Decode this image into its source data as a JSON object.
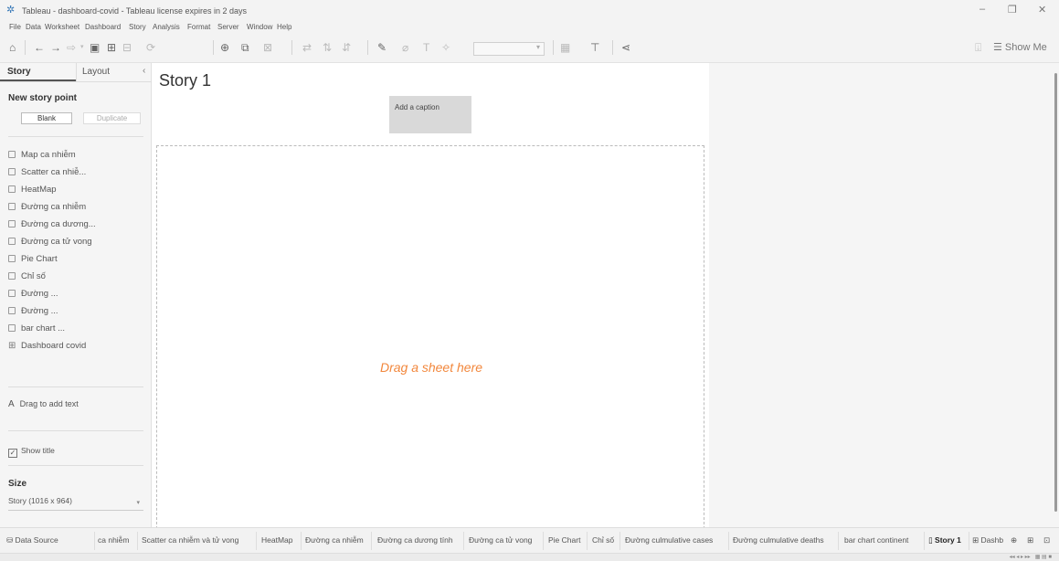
{
  "window": {
    "title": "Tableau - dashboard-covid - Tableau license expires in 2 days",
    "app_icon": "tableau-logo-icon"
  },
  "menu": [
    "File",
    "Data",
    "Worksheet",
    "Dashboard",
    "Story",
    "Analysis",
    "Format",
    "Server",
    "Window",
    "Help"
  ],
  "toolbar": {
    "show_me_label": "Show Me"
  },
  "sidebar": {
    "tabs": {
      "story": "Story",
      "layout": "Layout"
    },
    "new_story_point": "New story point",
    "blank_button": "Blank",
    "duplicate_button": "Duplicate",
    "sheets": [
      {
        "label": "Map ca nhiễm",
        "kind": "worksheet"
      },
      {
        "label": "Scatter ca nhiễ...",
        "kind": "worksheet"
      },
      {
        "label": "HeatMap",
        "kind": "worksheet"
      },
      {
        "label": "Đường ca nhiễm",
        "kind": "worksheet"
      },
      {
        "label": "Đường ca dương...",
        "kind": "worksheet"
      },
      {
        "label": "Đường ca tử vong",
        "kind": "worksheet"
      },
      {
        "label": "Pie Chart",
        "kind": "worksheet"
      },
      {
        "label": "Chỉ số",
        "kind": "worksheet"
      },
      {
        "label": "Đường ...",
        "kind": "worksheet"
      },
      {
        "label": "Đường ...",
        "kind": "worksheet"
      },
      {
        "label": "bar chart ...",
        "kind": "worksheet"
      },
      {
        "label": "Dashboard covid",
        "kind": "dashboard"
      }
    ],
    "drag_to_add_text": "Drag to add text",
    "show_title_label": "Show title",
    "show_title_checked": true,
    "size_label": "Size",
    "size_value": "Story (1016 x 964)"
  },
  "canvas": {
    "story_title": "Story 1",
    "caption_placeholder": "Add a caption",
    "drop_hint": "Drag a sheet here"
  },
  "bottom_tabs": [
    {
      "label": "Data Source",
      "icon": "database-icon"
    },
    {
      "label": "ca nhiễm"
    },
    {
      "label": "Scatter ca nhiễm và tử vong"
    },
    {
      "label": "HeatMap"
    },
    {
      "label": "Đường ca nhiễm"
    },
    {
      "label": "Đường ca dương tính"
    },
    {
      "label": "Đường ca tử vong"
    },
    {
      "label": "Pie Chart"
    },
    {
      "label": "Chỉ số"
    },
    {
      "label": "Đường culmulative cases"
    },
    {
      "label": "Đường culmulative deaths"
    },
    {
      "label": "bar chart continent"
    },
    {
      "label": "Story 1",
      "active": true,
      "icon": "story-icon"
    },
    {
      "label": "Dashb",
      "icon": "dashboard-icon"
    }
  ],
  "colors": {
    "drop_hint": "#f2873c",
    "caption_bg": "#d9d9d9"
  }
}
